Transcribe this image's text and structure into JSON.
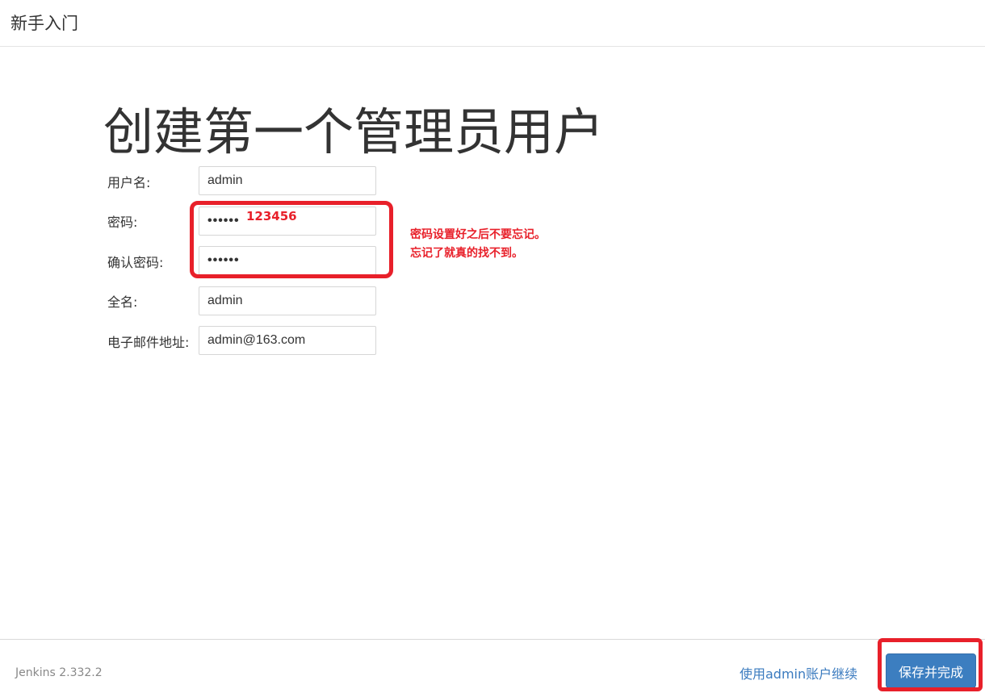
{
  "header": {
    "title": "新手入门"
  },
  "main": {
    "title": "创建第一个管理员用户",
    "fields": {
      "username": {
        "label": "用户名:",
        "value": "admin"
      },
      "password": {
        "label": "密码:",
        "value": "••••••"
      },
      "confirm_password": {
        "label": "确认密码:",
        "value": "••••••"
      },
      "fullname": {
        "label": "全名:",
        "value": "admin"
      },
      "email": {
        "label": "电子邮件地址:",
        "value": "admin@163.com"
      }
    }
  },
  "annotation": {
    "password_plain": "123456",
    "note_line1": "密码设置好之后不要忘记。",
    "note_line2": "忘记了就真的找不到。",
    "color": "#e8202a"
  },
  "footer": {
    "version": "Jenkins 2.332.2",
    "continue_link": "使用admin账户继续",
    "save_button": "保存并完成"
  },
  "colors": {
    "primary_button": "#3c7ec0",
    "link": "#3b7bbf"
  }
}
